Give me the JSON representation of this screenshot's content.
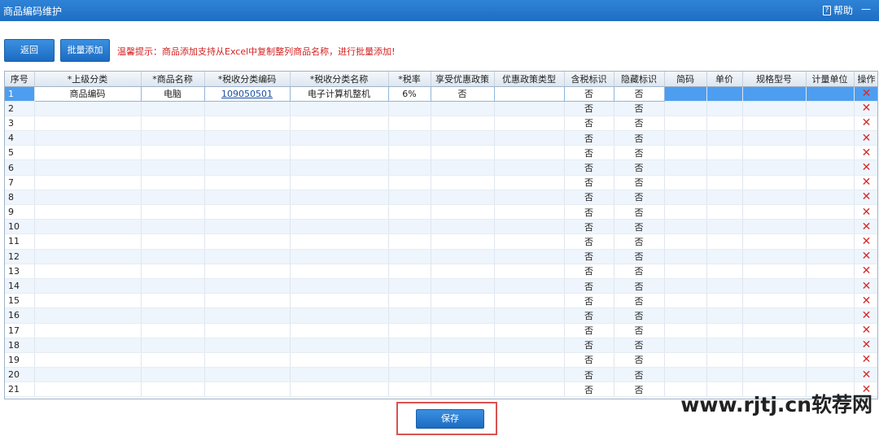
{
  "window": {
    "title": "商品编码维护",
    "help_label": "帮助",
    "minimize": "—"
  },
  "toolbar": {
    "back_label": "返回",
    "batch_add_label": "批量添加",
    "hint": "温馨提示：商品添加支持从Excel中复制整列商品名称，进行批量添加!"
  },
  "table": {
    "columns": [
      "序号",
      "*上级分类",
      "*商品名称",
      "*税收分类编码",
      "*税收分类名称",
      "*税率",
      "享受优惠政策",
      "优惠政策类型",
      "含税标识",
      "隐藏标识",
      "简码",
      "单价",
      "规格型号",
      "计量单位",
      "操作"
    ],
    "rows": [
      {
        "seq": "1",
        "parent": "商品编码",
        "name": "电脑",
        "tax_code": "109050501",
        "tax_name": "电子计算机整机",
        "rate": "6%",
        "preferential": "否",
        "policy_type": "",
        "tax_incl": "否",
        "hidden": "否"
      },
      {
        "seq": "2",
        "tax_incl": "否",
        "hidden": "否"
      },
      {
        "seq": "3",
        "tax_incl": "否",
        "hidden": "否"
      },
      {
        "seq": "4",
        "tax_incl": "否",
        "hidden": "否"
      },
      {
        "seq": "5",
        "tax_incl": "否",
        "hidden": "否"
      },
      {
        "seq": "6",
        "tax_incl": "否",
        "hidden": "否"
      },
      {
        "seq": "7",
        "tax_incl": "否",
        "hidden": "否"
      },
      {
        "seq": "8",
        "tax_incl": "否",
        "hidden": "否"
      },
      {
        "seq": "9",
        "tax_incl": "否",
        "hidden": "否"
      },
      {
        "seq": "10",
        "tax_incl": "否",
        "hidden": "否"
      },
      {
        "seq": "11",
        "tax_incl": "否",
        "hidden": "否"
      },
      {
        "seq": "12",
        "tax_incl": "否",
        "hidden": "否"
      },
      {
        "seq": "13",
        "tax_incl": "否",
        "hidden": "否"
      },
      {
        "seq": "14",
        "tax_incl": "否",
        "hidden": "否"
      },
      {
        "seq": "15",
        "tax_incl": "否",
        "hidden": "否"
      },
      {
        "seq": "16",
        "tax_incl": "否",
        "hidden": "否"
      },
      {
        "seq": "17",
        "tax_incl": "否",
        "hidden": "否"
      },
      {
        "seq": "18",
        "tax_incl": "否",
        "hidden": "否"
      },
      {
        "seq": "19",
        "tax_incl": "否",
        "hidden": "否"
      },
      {
        "seq": "20",
        "tax_incl": "否",
        "hidden": "否"
      },
      {
        "seq": "21",
        "tax_incl": "否",
        "hidden": "否"
      }
    ],
    "delete_icon": "✕"
  },
  "footer": {
    "save_label": "保存"
  },
  "watermark": "www.rjtj.cn软荐网",
  "colors": {
    "titlebar": "#1e6ec4",
    "selected_row": "#4d9ef0",
    "hint": "#d42020",
    "delete": "#d62a2a",
    "highlight_box": "#d9534f"
  }
}
